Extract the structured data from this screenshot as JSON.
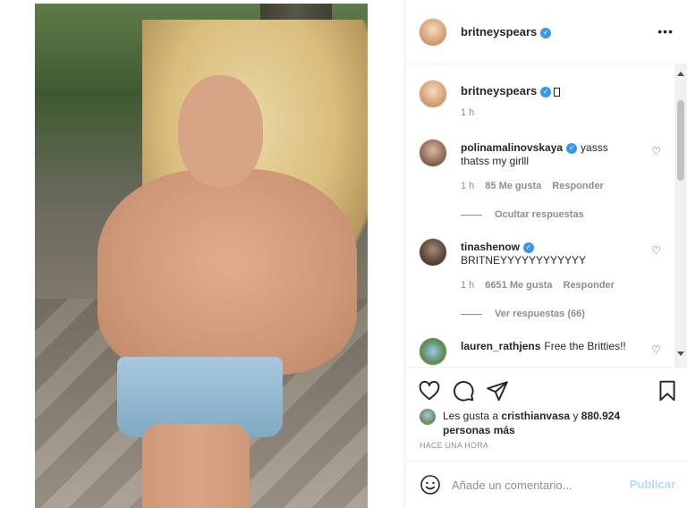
{
  "post": {
    "author": "britneyspears",
    "more_icon": "•••"
  },
  "caption": {
    "username": "britneyspears",
    "time": "1 h"
  },
  "comments": [
    {
      "username": "polinamalinovskaya",
      "text": "yasss thatss my girlll",
      "time": "1 h",
      "likes": "85 Me gusta",
      "reply": "Responder",
      "replies_toggle": "Ocultar respuestas"
    },
    {
      "username": "tinashenow",
      "text": "BRITNEYYYYYYYYYYYY",
      "time": "1 h",
      "likes": "6651 Me gusta",
      "reply": "Responder",
      "replies_toggle": "Ver respuestas (66)"
    },
    {
      "username": "lauren_rathjens",
      "text": "Free the Britties!!"
    }
  ],
  "likes": {
    "prefix": "Les gusta a ",
    "user": "cristhianvasa",
    "middle": " y ",
    "count": "880.924 personas más"
  },
  "timestamp": "HACE UNA HORA",
  "comment_form": {
    "placeholder": "Añade un comentario...",
    "publish": "Publicar"
  },
  "icons": {
    "like": "heart-icon",
    "comment": "comment-icon",
    "share": "send-icon",
    "save": "bookmark-icon",
    "verified": "verified-badge-icon"
  },
  "colors": {
    "verified": "#3897f0",
    "publish_disabled": "#b3dbff",
    "muted": "#8e8e8e"
  }
}
